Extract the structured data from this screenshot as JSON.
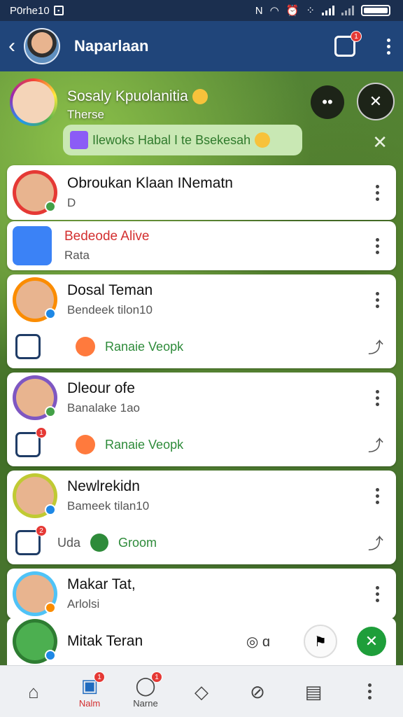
{
  "statusbar": {
    "carrier": "P0rhe10",
    "battery": "battery"
  },
  "header": {
    "title": "Naparlaan",
    "notification_count": "1"
  },
  "group": {
    "name": "Sosaly Kpuolanitia",
    "subtitle": "Therse",
    "pill_text": "Ilewoks Habal I te Bsekesah"
  },
  "contacts": [
    {
      "name": "Obroukan Klaan INematn",
      "sub": "D",
      "status_color": "#43a047",
      "ring": "#e53935"
    },
    {
      "name": "Bedeode Alive",
      "sub": "Rata",
      "name_color": "#d32f2f"
    },
    {
      "name": "Dosal Teman",
      "sub": "Bendeek tilon10",
      "status_color": "#1e88e5",
      "ring": "#fb8c00"
    },
    {
      "name": "Dleour ofe",
      "sub": "Banalake 1ao",
      "status_color": "#43a047",
      "ring": "#7e57c2"
    },
    {
      "name": "Newlrekidn",
      "sub": "Bameek tilan10",
      "status_color": "#1e88e5",
      "ring": "#c0ca33"
    },
    {
      "name": "Makar Tat,",
      "sub": "Arlolsi",
      "status_color": "#fb8c00",
      "ring": "#4fc3f7"
    }
  ],
  "subrows": [
    {
      "text": "Ranaie Veopk"
    },
    {
      "text": "Ranaie Veopk",
      "badge": "1"
    },
    {
      "label": "Uda",
      "text": "Groom",
      "badge": "2"
    }
  ],
  "bottom_contact": {
    "name": "Mitak Teran",
    "cam_label": "ɑ"
  },
  "nav": [
    {
      "label": ""
    },
    {
      "label": "Nalm",
      "badge": "1"
    },
    {
      "label": "Narne",
      "badge": "1"
    },
    {
      "label": ""
    },
    {
      "label": ""
    },
    {
      "label": ""
    }
  ]
}
